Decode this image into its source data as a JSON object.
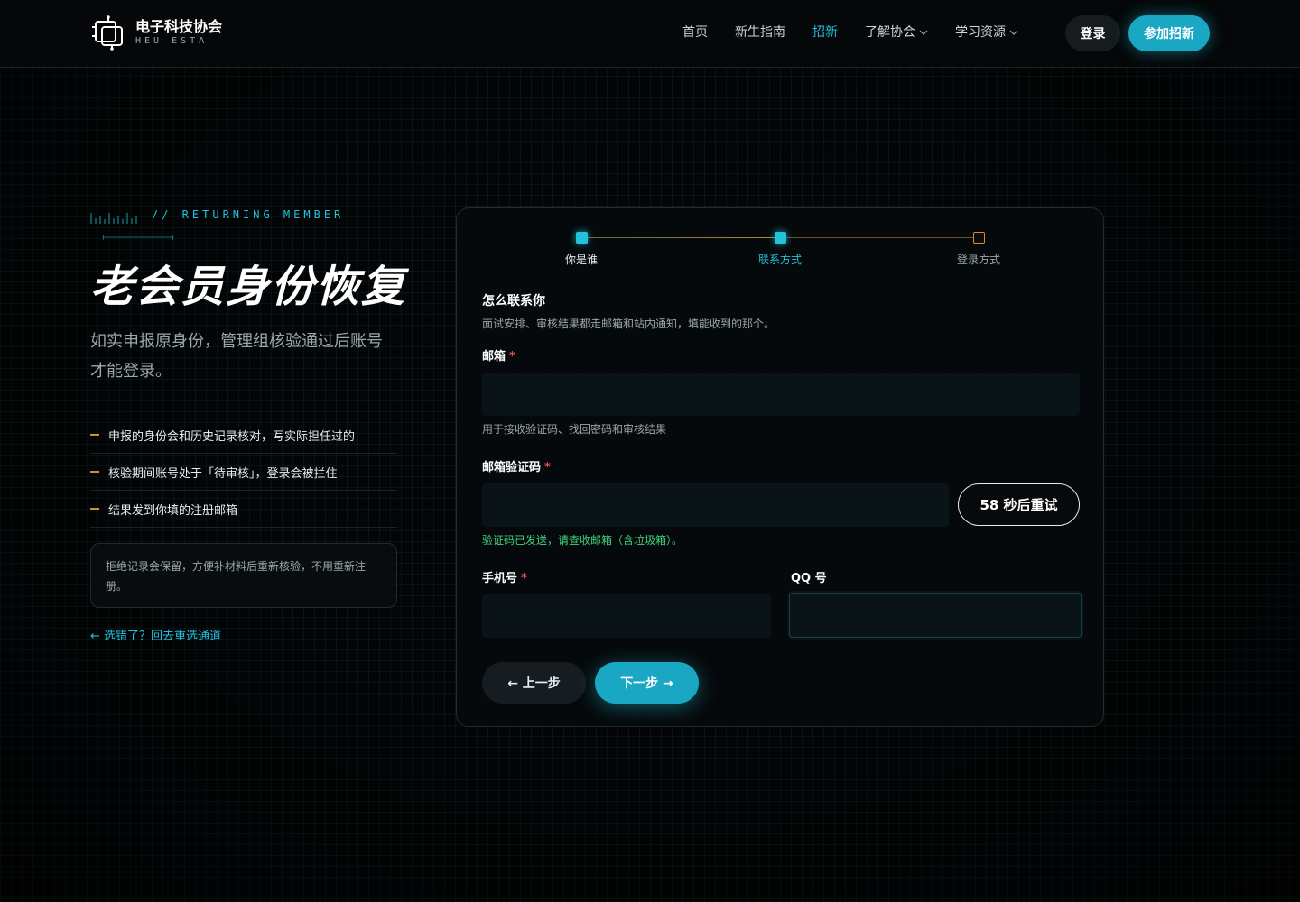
{
  "nav": {
    "logo_title": "电子科技协会",
    "logo_sub": "HEU ESTA",
    "links": [
      {
        "label": "首页",
        "active": false,
        "dropdown": false
      },
      {
        "label": "新生指南",
        "active": false,
        "dropdown": false
      },
      {
        "label": "招新",
        "active": true,
        "dropdown": false
      },
      {
        "label": "了解协会",
        "active": false,
        "dropdown": true
      },
      {
        "label": "学习资源",
        "active": false,
        "dropdown": true
      }
    ],
    "login_label": "登录",
    "join_label": "参加招新"
  },
  "hero": {
    "eyebrow": "// RETURNING MEMBER",
    "title": "老会员身份恢复",
    "description": "如实申报原身份，管理组核验通过后账号才能登录。",
    "bullets": [
      "申报的身份会和历史记录核对，写实际担任过的",
      "核验期间账号处于「待审核」，登录会被拦住",
      "结果发到你填的注册邮箱"
    ],
    "note": "拒绝记录会保留，方便补材料后重新核验，不用重新注册。",
    "back_link": "← 选错了？回去重选通道"
  },
  "steps": [
    {
      "label": "你是谁",
      "state": "done"
    },
    {
      "label": "联系方式",
      "state": "current"
    },
    {
      "label": "登录方式",
      "state": "todo"
    }
  ],
  "form": {
    "section_title": "怎么联系你",
    "section_sub": "面试安排、审核结果都走邮箱和站内通知，填能收到的那个。",
    "email_label": "邮箱",
    "email_value": "",
    "email_hint": "用于接收验证码、找回密码和审核结果",
    "code_label": "邮箱验证码",
    "code_value": "",
    "resend_label": "58 秒后重试",
    "code_hint": "验证码已发送，请查收邮箱（含垃圾箱）。",
    "phone_label": "手机号",
    "phone_value": "",
    "qq_label": "QQ 号",
    "qq_value": "",
    "required_mark": "*",
    "prev_label": "← 上一步",
    "next_label": "下一步 →"
  },
  "colors": {
    "accent": "#1aa7c4",
    "accent_text": "#22c1dc",
    "warning": "#d98a2b",
    "success": "#3fd17a",
    "required": "#e05252"
  }
}
